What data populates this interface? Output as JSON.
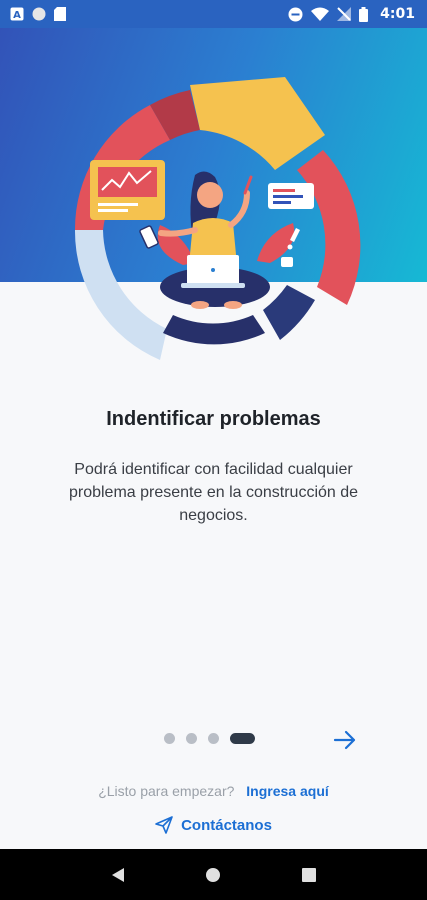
{
  "status_bar": {
    "time": "4:01",
    "left_icons": [
      "a-icon",
      "circle-icon",
      "sim-card-icon"
    ],
    "right_icons": [
      "do-not-disturb-icon",
      "wifi-icon",
      "no-signal-icon",
      "battery-icon"
    ]
  },
  "slide": {
    "title": "Indentificar problemas",
    "description": "Podrá identificar con facilidad cualquier problema presente en la construcción de negocios.",
    "page_count": 4,
    "active_page": 4
  },
  "footer": {
    "login_question": "¿Listo para empezar?",
    "login_link": "Ingresa aquí",
    "contact_label": "Contáctanos"
  },
  "colors": {
    "hero_gradient_start": "#3253b8",
    "hero_gradient_end": "#16b9d4",
    "accent": "#1c6fd4",
    "active_dot": "#2f3a48"
  },
  "nav_bar": {
    "buttons": [
      "back-icon",
      "home-icon",
      "recents-icon"
    ]
  }
}
